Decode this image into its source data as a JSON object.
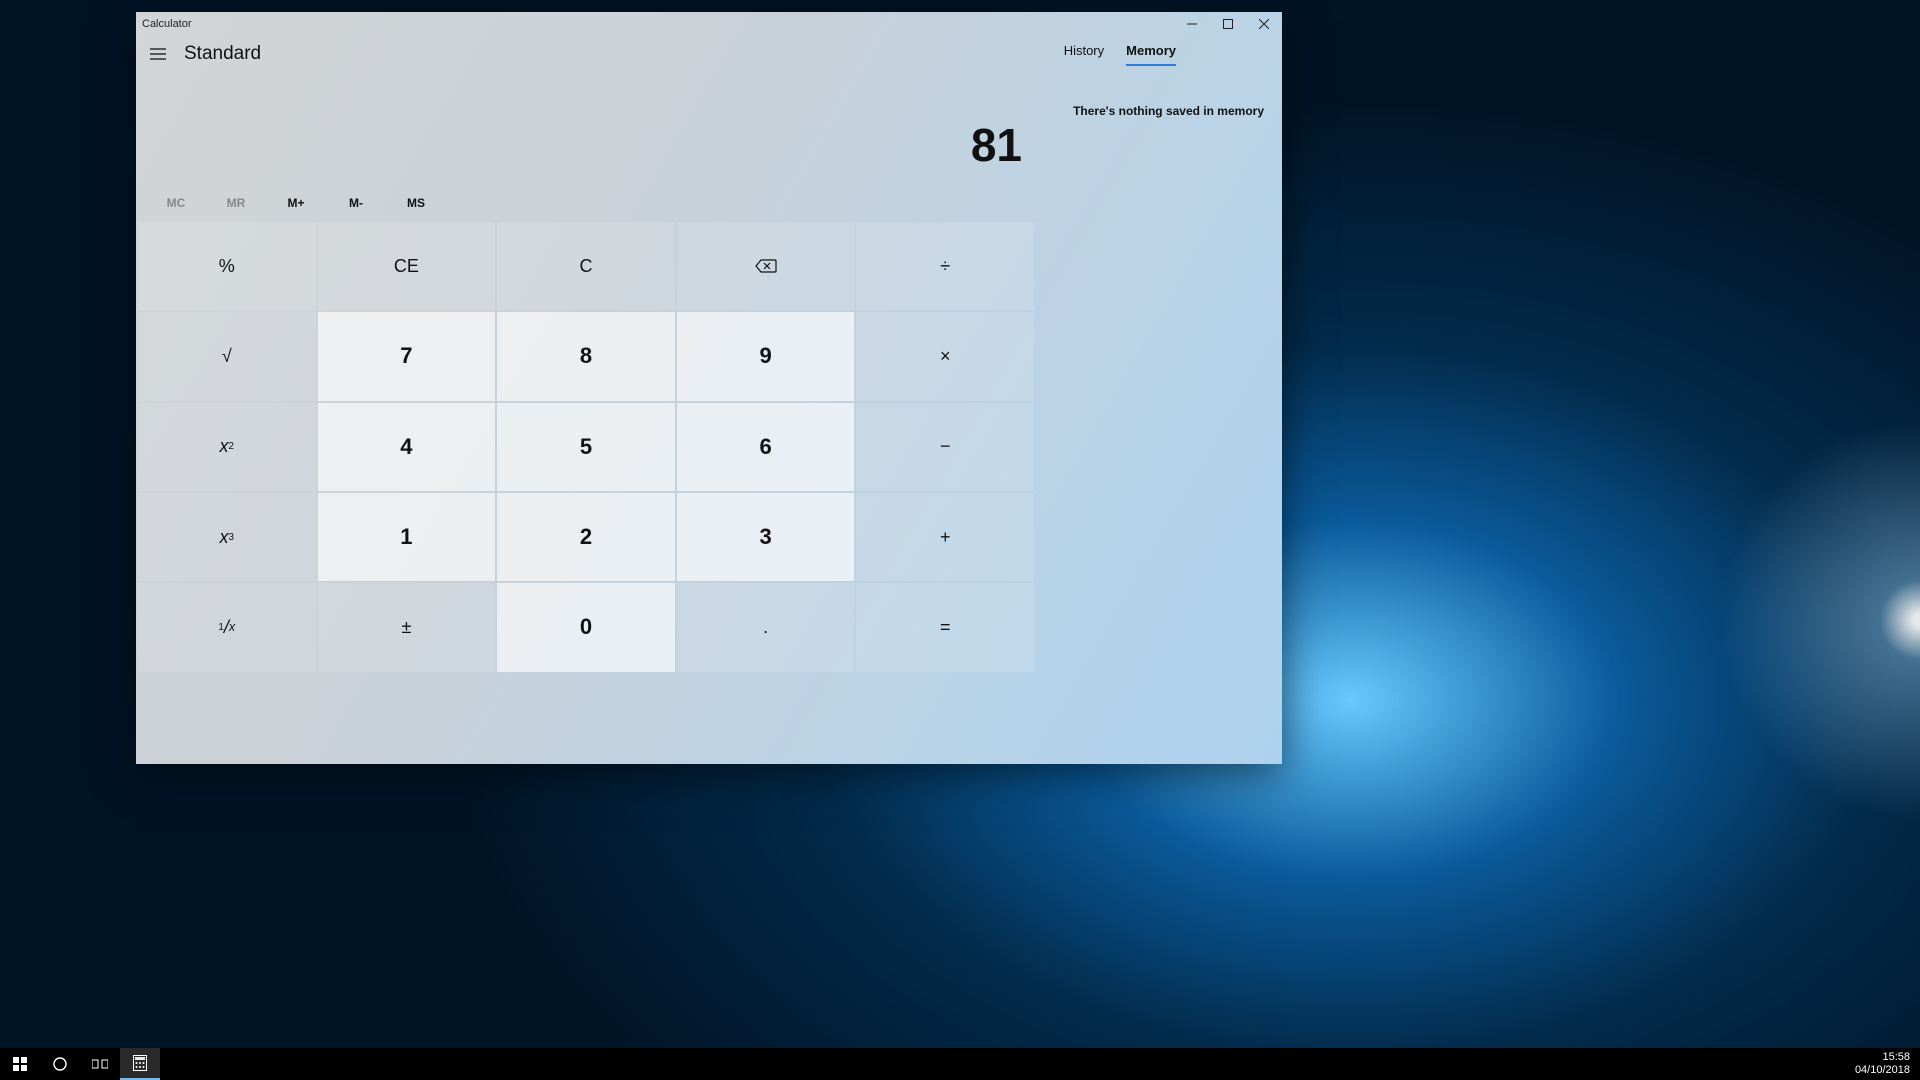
{
  "window": {
    "title": "Calculator"
  },
  "mode": "Standard",
  "tabs": {
    "history": "History",
    "memory": "Memory",
    "active": "memory"
  },
  "memory_empty": "There's nothing saved in memory",
  "display": "81",
  "memrow": {
    "mc": "MC",
    "mr": "MR",
    "mplus": "M+",
    "mminus": "M-",
    "ms": "MS"
  },
  "keys": {
    "percent": "%",
    "ce": "CE",
    "c": "C",
    "div": "÷",
    "sqrt": "√",
    "n7": "7",
    "n8": "8",
    "n9": "9",
    "mul": "×",
    "n4": "4",
    "n5": "5",
    "n6": "6",
    "sub": "−",
    "n1": "1",
    "n2": "2",
    "n3": "3",
    "add": "+",
    "recip_pre": "1",
    "recip_x": "x",
    "negate": "±",
    "n0": "0",
    "dot": ".",
    "eq": "="
  },
  "taskbar": {
    "time": "15:58",
    "date": "04/10/2018"
  }
}
